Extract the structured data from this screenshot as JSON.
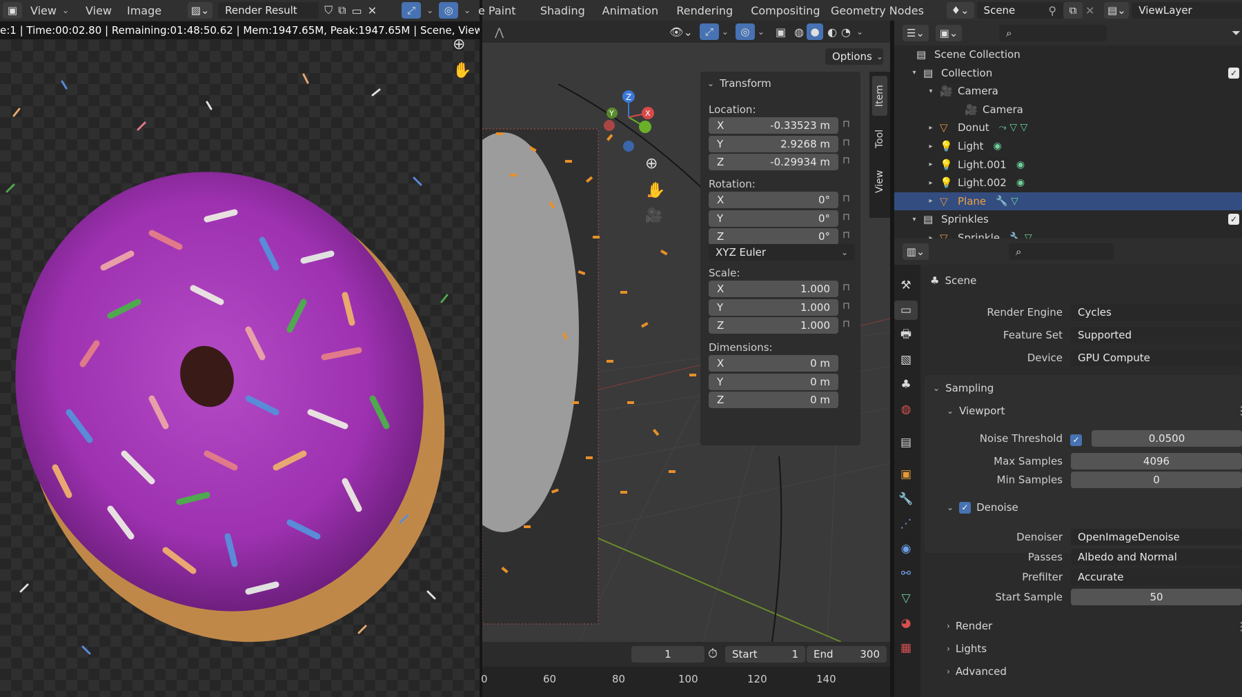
{
  "image_editor": {
    "menu_view_dd": "View",
    "menu_view": "View",
    "menu_image": "Image",
    "image_name": "Render Result",
    "status": "e:1 | Time:00:02.80 | Remaining:01:48:50.62 | Mem:1947.65M, Peak:1947.65M | Scene, ViewLaye"
  },
  "workspaces": [
    "e Paint",
    "Shading",
    "Animation",
    "Rendering",
    "Compositing",
    "Geometry Nodes"
  ],
  "scene_selector": {
    "label": "Scene"
  },
  "viewlayer_selector": {
    "label": "ViewLayer"
  },
  "viewport": {
    "options_label": "Options",
    "side_tabs": [
      "Item",
      "Tool",
      "View"
    ],
    "transform": {
      "title": "Transform",
      "location_label": "Location:",
      "location": [
        {
          "axis": "X",
          "value": "-0.33523 m"
        },
        {
          "axis": "Y",
          "value": "2.9268 m"
        },
        {
          "axis": "Z",
          "value": "-0.29934 m"
        }
      ],
      "rotation_label": "Rotation:",
      "rotation": [
        {
          "axis": "X",
          "value": "0°"
        },
        {
          "axis": "Y",
          "value": "0°"
        },
        {
          "axis": "Z",
          "value": "0°"
        }
      ],
      "rotation_mode": "XYZ Euler",
      "scale_label": "Scale:",
      "scale": [
        {
          "axis": "X",
          "value": "1.000"
        },
        {
          "axis": "Y",
          "value": "1.000"
        },
        {
          "axis": "Z",
          "value": "1.000"
        }
      ],
      "dimensions_label": "Dimensions:",
      "dimensions": [
        {
          "axis": "X",
          "value": "0 m"
        },
        {
          "axis": "Y",
          "value": "0 m"
        },
        {
          "axis": "Z",
          "value": "0 m"
        }
      ]
    },
    "gizmo": {
      "x": "X",
      "y": "Y",
      "z": "Z"
    }
  },
  "timeline": {
    "current_frame": "1",
    "start_label": "Start",
    "start_value": "1",
    "end_label": "End",
    "end_value": "300",
    "ticks": [
      "0",
      "60",
      "80",
      "100",
      "120",
      "140"
    ]
  },
  "outliner": {
    "items": [
      {
        "name": "Scene Collection"
      },
      {
        "name": "Collection"
      },
      {
        "name": "Camera"
      },
      {
        "name": "Camera"
      },
      {
        "name": "Donut"
      },
      {
        "name": "Light"
      },
      {
        "name": "Light.001"
      },
      {
        "name": "Light.002"
      },
      {
        "name": "Plane"
      },
      {
        "name": "Sprinkles"
      },
      {
        "name": "Sprinkle"
      }
    ]
  },
  "properties": {
    "context": "Scene",
    "render_engine_label": "Render Engine",
    "render_engine": "Cycles",
    "feature_set_label": "Feature Set",
    "feature_set": "Supported",
    "device_label": "Device",
    "device": "GPU Compute",
    "sampling": "Sampling",
    "viewport": "Viewport",
    "noise_threshold_label": "Noise Threshold",
    "noise_threshold": "0.0500",
    "max_samples_label": "Max Samples",
    "max_samples": "4096",
    "min_samples_label": "Min Samples",
    "min_samples": "0",
    "denoise": "Denoise",
    "denoiser_label": "Denoiser",
    "denoiser": "OpenImageDenoise",
    "passes_label": "Passes",
    "passes": "Albedo and Normal",
    "prefilter_label": "Prefilter",
    "prefilter": "Accurate",
    "start_sample_label": "Start Sample",
    "start_sample": "50",
    "render": "Render",
    "lights": "Lights",
    "advanced": "Advanced"
  },
  "colors": {
    "accent": "#4772b3",
    "selected_row": "#334d80",
    "object_orange": "#e49a3c",
    "data_green": "#6ed19a",
    "donut_purple": "#a43bb5"
  }
}
